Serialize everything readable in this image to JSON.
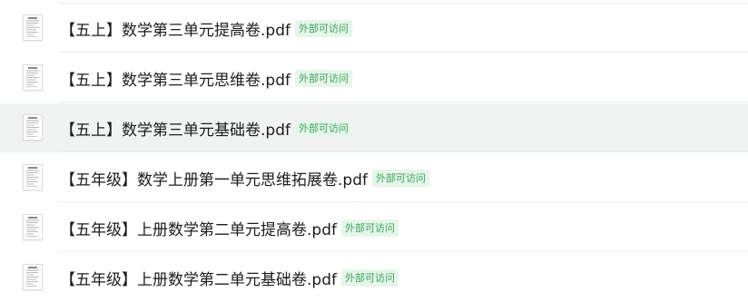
{
  "colors": {
    "badge_bg": "#e6f6ea",
    "badge_text": "#3aa35a",
    "hover_row_bg": "#f1f2f2"
  },
  "files": [
    {
      "name": "【五上】数学第三单元提高卷.pdf",
      "badge": "外部可访问",
      "icon": "pdf-document-icon",
      "highlighted": false
    },
    {
      "name": "【五上】数学第三单元思维卷.pdf",
      "badge": "外部可访问",
      "icon": "pdf-document-icon",
      "highlighted": false
    },
    {
      "name": "【五上】数学第三单元基础卷.pdf",
      "badge": "外部可访问",
      "icon": "pdf-document-icon",
      "highlighted": true
    },
    {
      "name": "【五年级】数学上册第一单元思维拓展卷.pdf",
      "badge": "外部可访问",
      "icon": "pdf-document-icon",
      "highlighted": false
    },
    {
      "name": "【五年级】上册数学第二单元提高卷.pdf",
      "badge": "外部可访问",
      "icon": "pdf-document-icon",
      "highlighted": false
    },
    {
      "name": "【五年级】上册数学第二单元基础卷.pdf",
      "badge": "外部可访问",
      "icon": "pdf-document-icon",
      "highlighted": false
    }
  ]
}
